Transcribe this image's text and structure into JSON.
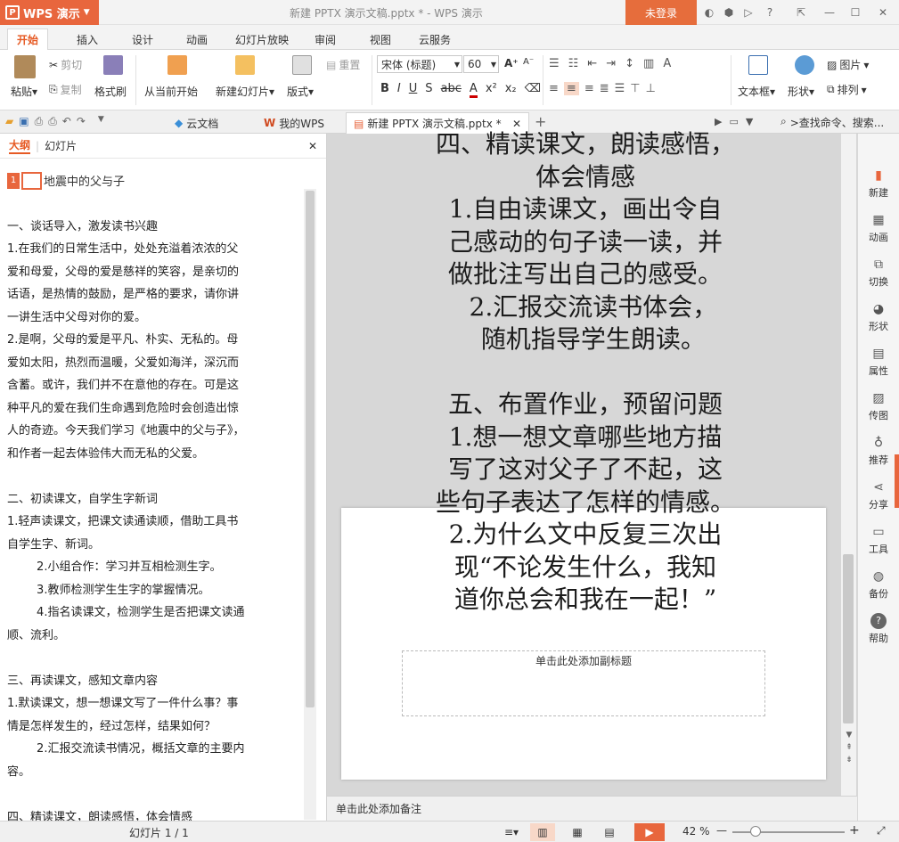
{
  "app": {
    "name": "WPS 演示",
    "logo_char": "P",
    "window_title": "新建 PPTX 演示文稿.pptx * - WPS 演示",
    "login_label": "未登录"
  },
  "tabs": [
    "开始",
    "插入",
    "设计",
    "动画",
    "幻灯片放映",
    "审阅",
    "视图",
    "云服务"
  ],
  "ribbon": {
    "paste": "粘贴",
    "cut": "剪切",
    "copy": "复制",
    "format_painter": "格式刷",
    "from_current": "从当前开始",
    "new_slide": "新建幻灯片",
    "layout": "版式",
    "reset": "重置",
    "font_name": "宋体 (标题)",
    "font_size": "60",
    "textbox": "文本框",
    "shape": "形状",
    "picture": "图片",
    "arrange": "排列"
  },
  "doc_tabs": {
    "cloud": "云文档",
    "mywps": "我的WPS",
    "current": "新建 PPTX 演示文稿.pptx *",
    "search": ">查找命令、搜索..."
  },
  "left_panel": {
    "tab_outline": "大纲",
    "tab_slides": "幻灯片",
    "slide_number": "1",
    "slide_title": "地震中的父与子",
    "outline": [
      "",
      "一、谈话导入，激发读书兴趣",
      "1.在我们的日常生活中，处处充溢着浓浓的父",
      "爱和母爱，父母的爱是慈祥的笑容，是亲切的",
      "话语，是热情的鼓励，是严格的要求，请你讲",
      "一讲生活中父母对你的爱。",
      "2.是啊，父母的爱是平凡、朴实、无私的。母",
      "爱如太阳，热烈而温暖，父爱如海洋，深沉而",
      "含蓄。或许，我们并不在意他的存在。可是这",
      "种平凡的爱在我们生命遇到危险时会创造出惊",
      "人的奇迹。今天我们学习《地震中的父与子》，",
      "和作者一起去体验伟大而无私的父爱。",
      "",
      "二、初读课文，自学生字新词",
      "1.轻声读课文，把课文读通读顺，借助工具书",
      "自学生字、新词。",
      "        2.小组合作：学习并互相检测生字。",
      "        3.教师检测学生生字的掌握情况。",
      "        4.指名读课文，检测学生是否把课文读通",
      "顺、流利。",
      "",
      "三、再读课文，感知文章内容",
      "1.默读课文，想一想课文写了一件什么事？事",
      "情是怎样发生的，经过怎样，结果如何？",
      "        2.汇报交流读书情况，概括文章的主要内",
      "容。",
      "",
      "四、精读课文，朗读感悟，体会情感"
    ]
  },
  "slide": {
    "body_lines": [
      "四、精读课文，朗读感悟，",
      "体会情感",
      "1.自由读课文，画出令自",
      "己感动的句子读一读，并",
      "做批注写出自己的感受。",
      "  2.汇报交流读书体会，",
      "  随机指导学生朗读。",
      "",
      "五、布置作业，预留问题",
      "1.想一想文章哪些地方描",
      "写了这对父子了不起，这",
      "些句子表达了怎样的情感。",
      "2.为什么文中反复三次出",
      "现“不论发生什么，我知",
      "道你总会和我在一起！”"
    ],
    "subtitle_placeholder": "单击此处添加副标题"
  },
  "notes_placeholder": "单击此处添加备注",
  "right_bar": [
    "新建",
    "动画",
    "切换",
    "形状",
    "属性",
    "传图",
    "推荐",
    "分享",
    "工具",
    "备份",
    "帮助"
  ],
  "status": {
    "slide_counter": "幻灯片 1 / 1",
    "zoom": "42 %"
  },
  "colors": {
    "accent": "#e8663d",
    "login_bg": "#e66d3c"
  }
}
